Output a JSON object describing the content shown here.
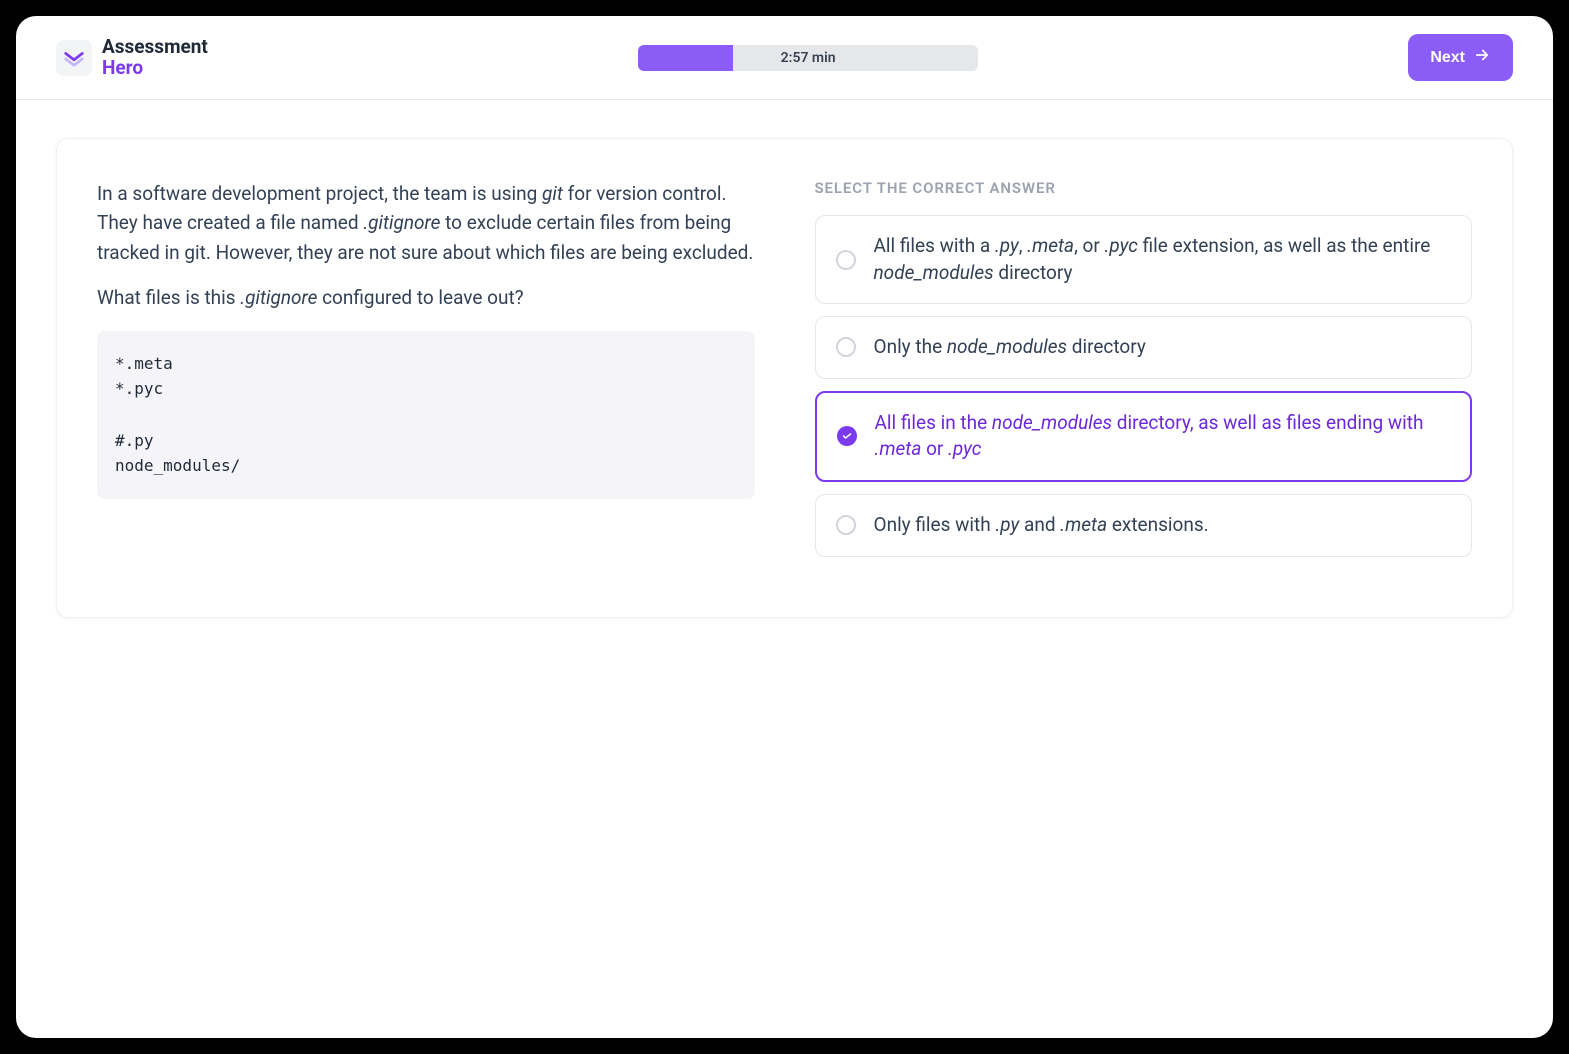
{
  "header": {
    "brand_line1": "Assessment",
    "brand_line2": "Hero",
    "timer": "2:57 min",
    "next_label": "Next"
  },
  "question": {
    "p1_a": "In a software development project, the team is using ",
    "p1_i1": "git",
    "p1_b": " for version control. They have created a file named ",
    "p1_i2": ".gitignore",
    "p1_c": " to exclude certain files from being tracked in git. However, they are not sure about which files are being excluded.",
    "p2_a": "What files is this ",
    "p2_i1": ".gitignore",
    "p2_b": " configured to leave out?",
    "code": "*.meta\n*.pyc\n\n#.py\nnode_modules/"
  },
  "answers": {
    "heading": "SELECT THE CORRECT ANSWER",
    "selected_index": 2,
    "options": [
      {
        "segs": [
          {
            "t": "All files with a ",
            "i": false
          },
          {
            "t": ".py",
            "i": true
          },
          {
            "t": ", ",
            "i": false
          },
          {
            "t": ".meta",
            "i": true
          },
          {
            "t": ", or ",
            "i": false
          },
          {
            "t": ".pyc",
            "i": true
          },
          {
            "t": " file extension, as well as the entire ",
            "i": false
          },
          {
            "t": "node_modules",
            "i": true
          },
          {
            "t": " directory",
            "i": false
          }
        ]
      },
      {
        "segs": [
          {
            "t": "Only the ",
            "i": false
          },
          {
            "t": "node_modules",
            "i": true
          },
          {
            "t": " directory",
            "i": false
          }
        ]
      },
      {
        "segs": [
          {
            "t": "All files in the ",
            "i": false
          },
          {
            "t": "node_modules",
            "i": true
          },
          {
            "t": " directory, as well as files ending with ",
            "i": false
          },
          {
            "t": ".meta",
            "i": true
          },
          {
            "t": " or ",
            "i": false
          },
          {
            "t": ".pyc",
            "i": true
          }
        ]
      },
      {
        "segs": [
          {
            "t": "Only files with ",
            "i": false
          },
          {
            "t": ".py",
            "i": true
          },
          {
            "t": " and ",
            "i": false
          },
          {
            "t": ".meta",
            "i": true
          },
          {
            "t": " extensions.",
            "i": false
          }
        ]
      }
    ]
  }
}
